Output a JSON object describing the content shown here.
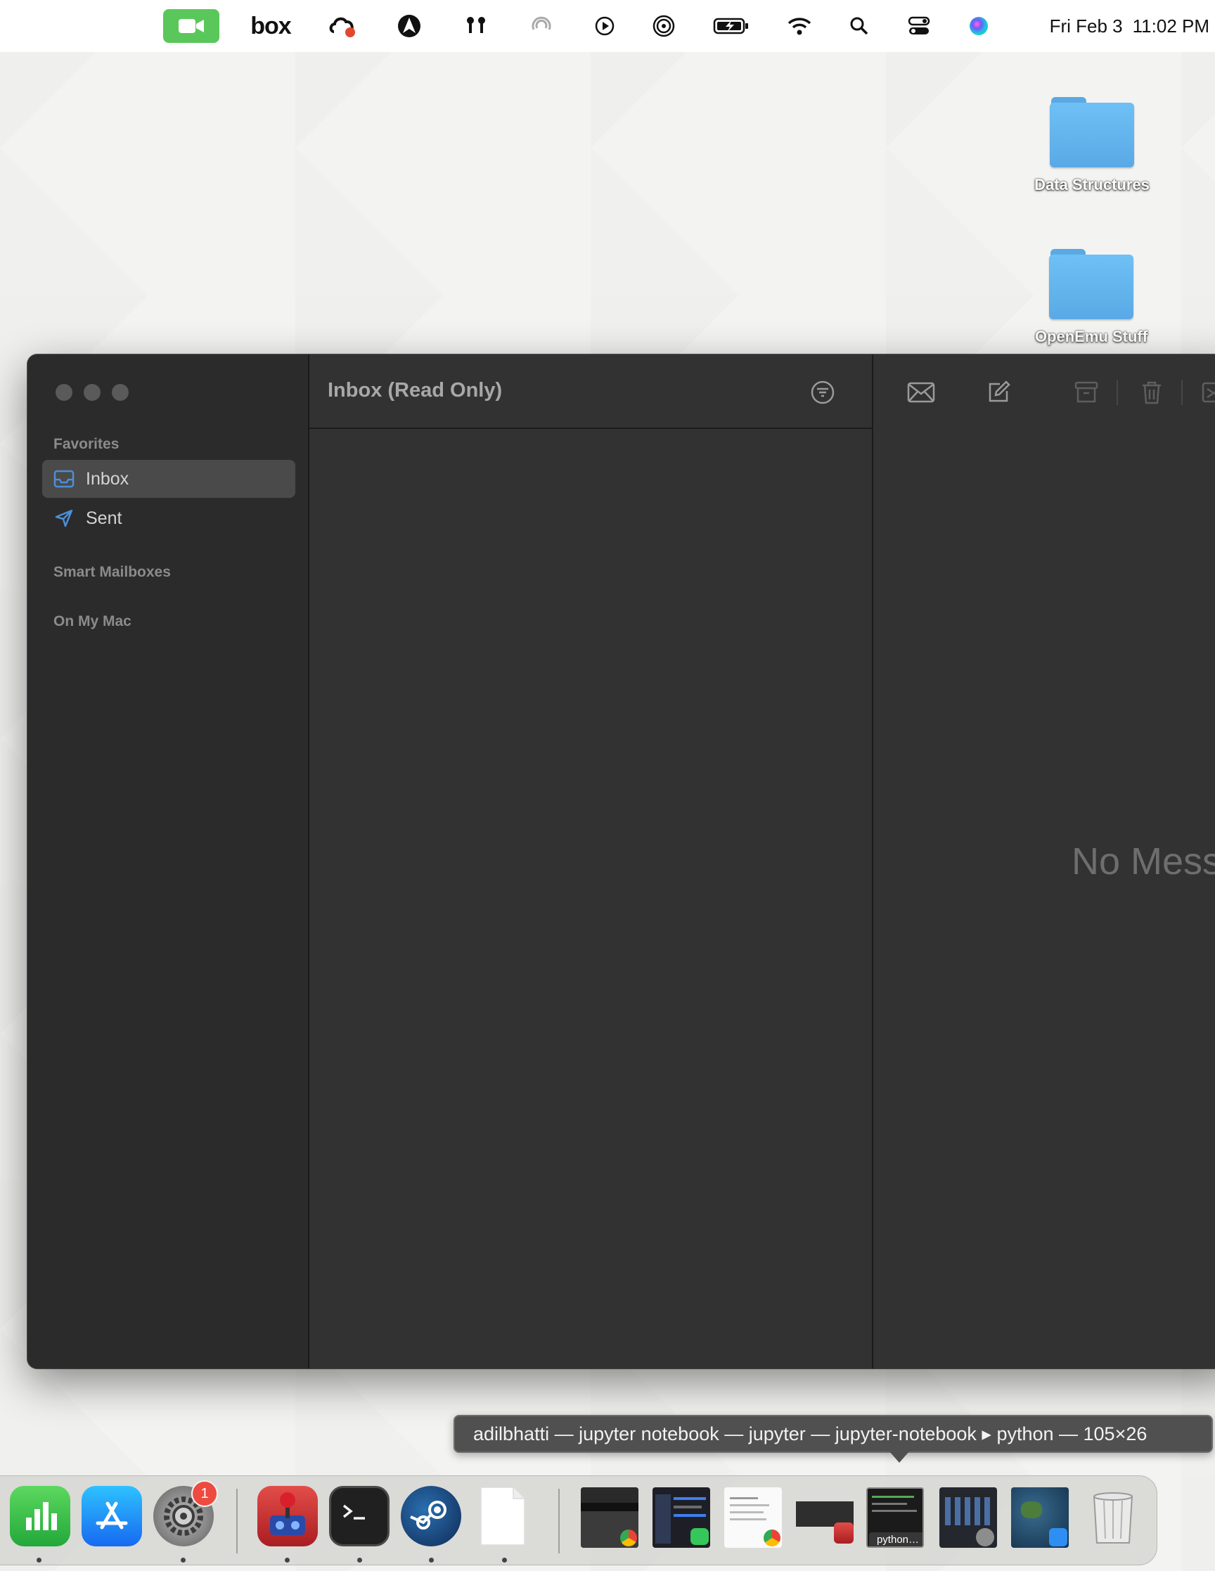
{
  "menubar": {
    "box_label": "box",
    "date": "Fri Feb 3",
    "time": "11:02 PM",
    "icons": [
      "facetime-icon",
      "box-icon",
      "creative-cloud-icon",
      "astro-icon",
      "airpods-icon",
      "focus-icon",
      "play-icon",
      "airdrop-icon",
      "battery-icon",
      "wifi-icon",
      "search-icon",
      "control-center-icon",
      "siri-icon"
    ]
  },
  "desktop": {
    "items": [
      {
        "label": "Data Structures",
        "icon": "folder-icon"
      },
      {
        "label": "OpenEmu Stuff",
        "icon": "folder-icon"
      }
    ]
  },
  "mail": {
    "sidebar": {
      "favorites_heading": "Favorites",
      "inbox_label": "Inbox",
      "sent_label": "Sent",
      "smart_mailboxes_heading": "Smart Mailboxes",
      "on_my_mac_heading": "On My Mac"
    },
    "list": {
      "title": "Inbox (Read Only)"
    },
    "reader": {
      "empty_text": "No Message Selected"
    }
  },
  "tooltip": {
    "text": "adilbhatti — jupyter notebook — jupyter — jupyter-notebook ▸ python — 105×26"
  },
  "dock": {
    "apps": [
      "numbers-icon",
      "app-store-icon",
      "system-settings-icon",
      "openemu-icon",
      "terminal-icon",
      "steam-icon",
      "document-icon"
    ],
    "settings_badge": "1",
    "window_thumb_label": "python…",
    "colors": {
      "accent_red": "#ef4a3f",
      "folder_blue": "#5aa9e6",
      "facetime_green": "#5ac75a"
    }
  }
}
